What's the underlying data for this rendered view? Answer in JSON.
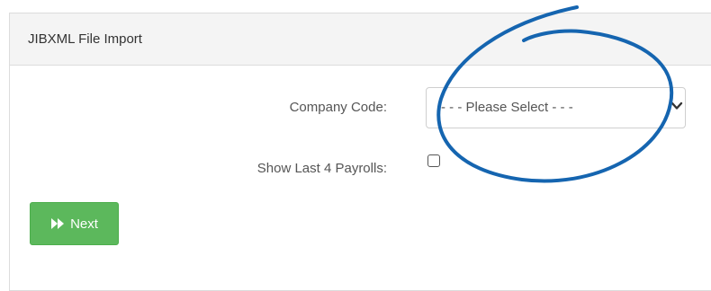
{
  "panel": {
    "title": "JIBXML File Import"
  },
  "form": {
    "company_code_label": "Company Code:",
    "company_code_value": "- - - Please Select - - -",
    "show_payrolls_label": "Show Last 4 Payrolls:",
    "show_payrolls_checked": false
  },
  "actions": {
    "next_label": "Next",
    "next_icon": "fast-forward-icon",
    "button_color": "#5cb85c"
  },
  "annotation": {
    "color": "#1565b0"
  }
}
